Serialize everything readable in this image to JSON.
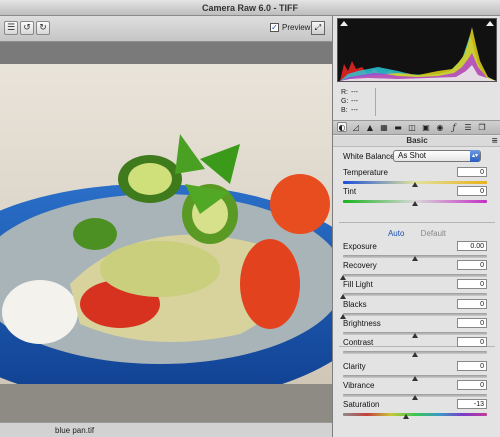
{
  "window": {
    "title": "Camera Raw 6.0  -  TIFF"
  },
  "toolbar": {
    "preview_label": "Preview",
    "preview_checked": "✓"
  },
  "image": {
    "filename": "blue pan.tif"
  },
  "histogram": {
    "r_label": "R:",
    "r_value": "---",
    "g_label": "G:",
    "g_value": "---",
    "b_label": "B:",
    "b_value": "---"
  },
  "panel": {
    "section_title": "Basic",
    "white_balance": {
      "label": "White Balance:",
      "value": "As Shot"
    },
    "auto_label": "Auto",
    "default_label": "Default",
    "controls": [
      {
        "label": "Temperature",
        "value": "0",
        "track": "temp",
        "level": 0.5
      },
      {
        "label": "Tint",
        "value": "0",
        "track": "tint",
        "level": 0.5
      },
      {
        "label": "Exposure",
        "value": "0.00",
        "track": "plain",
        "level": 0.5
      },
      {
        "label": "Recovery",
        "value": "0",
        "track": "plain",
        "level": 0.0
      },
      {
        "label": "Fill Light",
        "value": "0",
        "track": "plain",
        "level": 0.0
      },
      {
        "label": "Blacks",
        "value": "0",
        "track": "plain",
        "level": 0.0
      },
      {
        "label": "Brightness",
        "value": "0",
        "track": "plain",
        "level": 0.5
      },
      {
        "label": "Contrast",
        "value": "0",
        "track": "plain",
        "level": 0.5
      },
      {
        "label": "Clarity",
        "value": "0",
        "track": "plain",
        "level": 0.5
      },
      {
        "label": "Vibrance",
        "value": "0",
        "track": "plain",
        "level": 0.5
      },
      {
        "label": "Saturation",
        "value": "-13",
        "track": "sat",
        "level": 0.44
      }
    ]
  }
}
